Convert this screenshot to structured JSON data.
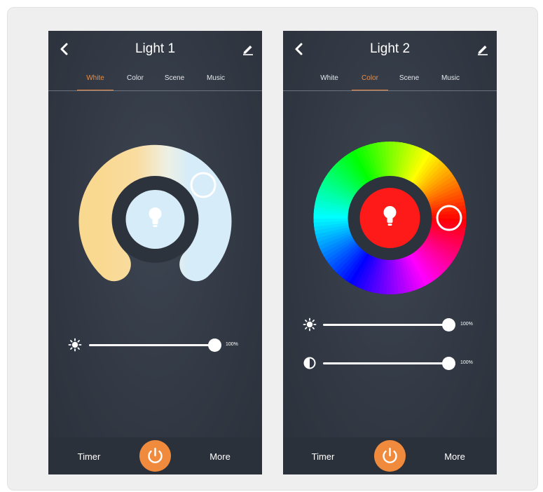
{
  "colors": {
    "accent": "#f08a3c",
    "panel_bg": "#323944",
    "warm_white": "#f9d88f",
    "cool_white": "#d6ecf8",
    "selected_color": "#ff1a1a"
  },
  "phones": [
    {
      "title": "Light 1",
      "back_icon": "chevron-left-icon",
      "edit_icon": "pencil-icon",
      "tabs": [
        {
          "label": "White",
          "active": true
        },
        {
          "label": "Color",
          "active": false
        },
        {
          "label": "Scene",
          "active": false
        },
        {
          "label": "Music",
          "active": false
        }
      ],
      "wheel": {
        "mode": "white",
        "center_icon": "bulb-icon"
      },
      "sliders": [
        {
          "icon": "brightness-icon",
          "value": 100,
          "value_label": "100%"
        }
      ],
      "footer": {
        "left": "Timer",
        "right": "More",
        "power_icon": "power-icon"
      }
    },
    {
      "title": "Light 2",
      "back_icon": "chevron-left-icon",
      "edit_icon": "pencil-icon",
      "tabs": [
        {
          "label": "White",
          "active": false
        },
        {
          "label": "Color",
          "active": true
        },
        {
          "label": "Scene",
          "active": false
        },
        {
          "label": "Music",
          "active": false
        }
      ],
      "wheel": {
        "mode": "color",
        "center_icon": "bulb-icon"
      },
      "sliders": [
        {
          "icon": "brightness-icon",
          "value": 100,
          "value_label": "100%"
        },
        {
          "icon": "contrast-icon",
          "value": 100,
          "value_label": "100%"
        }
      ],
      "footer": {
        "left": "Timer",
        "right": "More",
        "power_icon": "power-icon"
      }
    }
  ]
}
